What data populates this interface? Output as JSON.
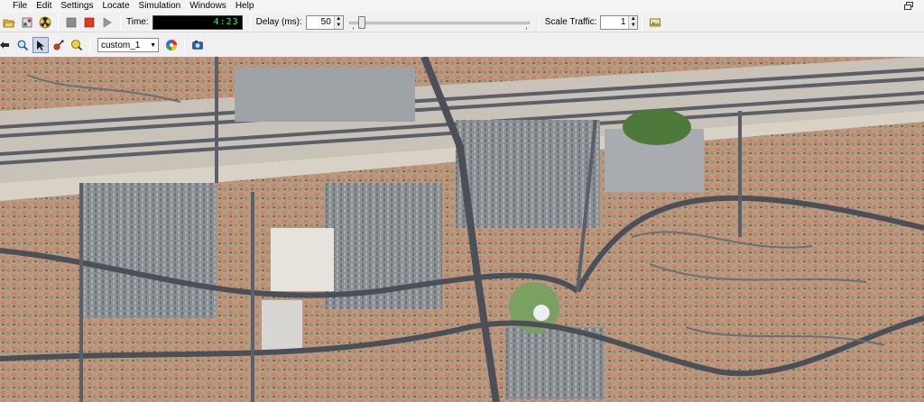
{
  "menu": {
    "items": [
      {
        "label": "File"
      },
      {
        "label": "Edit"
      },
      {
        "label": "Settings"
      },
      {
        "label": "Locate"
      },
      {
        "label": "Simulation"
      },
      {
        "label": "Windows"
      },
      {
        "label": "Help"
      }
    ]
  },
  "toolbar": {
    "time_label": "Time:",
    "time_value": "4:23",
    "delay_label": "Delay (ms):",
    "delay_value": "50",
    "delay_slider_level": 0.05,
    "scale_label": "Scale Traffic:",
    "scale_value": "1"
  },
  "toolbar2": {
    "view_select": "custom_1"
  },
  "icons": {
    "open": "folder-open-icon",
    "reload": "reload-icon",
    "radiation": "radiation-icon",
    "stop": "stop-icon",
    "run": "run-icon",
    "step": "step-icon",
    "pan": "pan-icon",
    "zoom": "zoom-icon",
    "select": "select-icon",
    "inspect": "inspect-icon",
    "locate": "locate-icon",
    "color_wheel": "color-wheel-icon",
    "screenshot": "screenshot-icon",
    "gallery": "gallery-icon"
  },
  "colors": {
    "time_digits": "#26ff3c",
    "stop_red": "#e23a1c"
  }
}
